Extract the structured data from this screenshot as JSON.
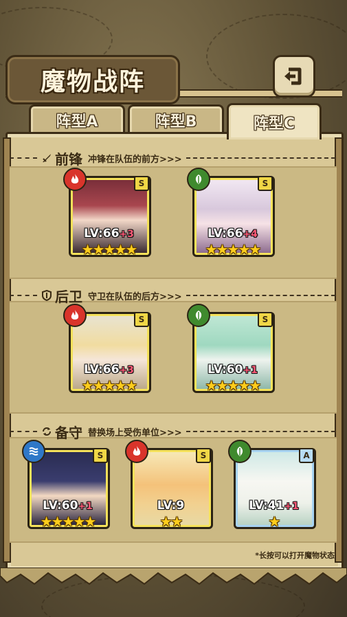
{
  "title": "魔物战阵",
  "back_icon": "return-arrow-icon",
  "tabs": [
    {
      "label": "阵型A",
      "active": false
    },
    {
      "label": "阵型B",
      "active": false
    },
    {
      "label": "阵型C",
      "active": true
    }
  ],
  "sections": {
    "front": {
      "icon": "sword-icon",
      "title": "前锋",
      "desc": "冲锋在队伍的前方>>>"
    },
    "back": {
      "icon": "shield-icon",
      "title": "后卫",
      "desc": "守卫在队伍的后方>>>"
    },
    "reserve": {
      "icon": "swap-icon",
      "title": "备守",
      "desc": "替换场上受伤单位>>>"
    }
  },
  "cards": [
    {
      "element": "fire",
      "rank": "S",
      "level": "LV:66",
      "bonus": "+3",
      "stars": 5
    },
    {
      "element": "leaf",
      "rank": "S",
      "level": "LV:66",
      "bonus": "+4",
      "stars": 5
    },
    {
      "element": "fire",
      "rank": "S",
      "level": "LV:66",
      "bonus": "+3",
      "stars": 5
    },
    {
      "element": "leaf",
      "rank": "S",
      "level": "LV:60",
      "bonus": "+1",
      "stars": 5
    },
    {
      "element": "water",
      "rank": "S",
      "level": "LV:60",
      "bonus": "+1",
      "stars": 5
    },
    {
      "element": "fire",
      "rank": "S",
      "level": "LV:9",
      "bonus": "",
      "stars": 2
    },
    {
      "element": "leaf",
      "rank": "A",
      "level": "LV:41",
      "bonus": "+1",
      "stars": 1
    }
  ],
  "footer_note": "*长按可以打开魔物状态",
  "colors": {
    "fire": "#d9342b",
    "leaf": "#3f8a2e",
    "water": "#2f78c8",
    "star": "#ffcd1c",
    "bonus": "#ff5a78"
  }
}
